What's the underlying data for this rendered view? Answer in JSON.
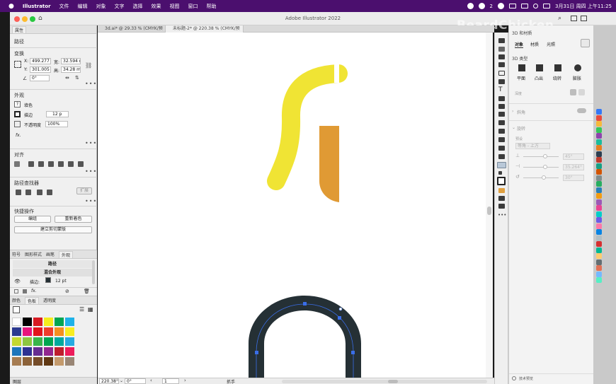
{
  "menubar": {
    "app": "Illustrator",
    "items": [
      "文件",
      "编辑",
      "对象",
      "文字",
      "选择",
      "效果",
      "视图",
      "窗口",
      "帮助"
    ],
    "clock": "3月31日 周四 上午11:25",
    "status_badge": "2"
  },
  "window": {
    "title": "Adobe Illustrator 2022",
    "watermark": "BeardChicken"
  },
  "doc_tabs": [
    "3d.ai* @ 29.33 % (CMYK/预览)",
    "未标题-2* @ 220.38 % (CMYK/预览)"
  ],
  "properties": {
    "tab": "属性",
    "object_type": "路径",
    "transform": {
      "title": "变换",
      "x_label": "X:",
      "x": "499.277",
      "y_label": "Y:",
      "y": "301.005",
      "w_label": "宽:",
      "w": "32.594 r",
      "h_label": "高:",
      "h": "34.28 m",
      "angle": "0°"
    },
    "appearance": {
      "title": "外观",
      "fill_label": "填色",
      "stroke_label": "描边",
      "stroke_value": "12 p",
      "opacity_label": "不透明度",
      "opacity_value": "100%",
      "fx": "fx."
    },
    "align_title": "对齐",
    "pathfinder": {
      "title": "路径查找器",
      "expand": "扩展"
    },
    "quick_actions": {
      "title": "快捷操作",
      "edit": "编组",
      "recolor": "重新着色",
      "clip": "建立剪切蒙版"
    }
  },
  "appearance_panel": {
    "tabs": [
      "符号",
      "图形样式",
      "画笔",
      "外观"
    ],
    "rows": {
      "path": "路径",
      "mixed": "混合外观",
      "stroke_label": "描边:",
      "stroke_value": "12 pt"
    }
  },
  "swatches_panel": {
    "tabs": [
      "颜色",
      "色板",
      "透明度"
    ]
  },
  "bottom_tab": "图层",
  "statusbar": {
    "zoom": "220.38°",
    "angle": "0°",
    "artboard": "1",
    "tool": "抓手"
  },
  "threed_panel": {
    "title": "3D 和材质",
    "tabs": [
      "对象",
      "材质",
      "光照"
    ],
    "section": "3D 类型",
    "types": [
      "平面",
      "凸出",
      "绕转",
      "膨胀"
    ],
    "depth_label": "深度",
    "bevel": "斜角",
    "rotation": "旋转",
    "preset_label": "预设",
    "preset_value": "等角 - 上方",
    "angle1": "45°",
    "angle2": "35.264°",
    "angle3": "30°",
    "footer": "技术预览"
  },
  "colors": {
    "menubar": "#4b0f6e",
    "yellow_curve": "#f0e434",
    "orange_rect": "#e09a34",
    "arch": "#253035",
    "anchor": "#3a6ee8"
  },
  "swatch_colors": [
    "#ffffff",
    "#000000",
    "#d71b23",
    "#f5ec1c",
    "#00a551",
    "#1fb2e8",
    "#2b3990",
    "#e8147d",
    "#e2141c",
    "#ee3d2b",
    "#f48f1f",
    "#f8ed20",
    "#c5d82f",
    "#8dc63f",
    "#39b54a",
    "#00a650",
    "#00a99d",
    "#27aae1",
    "#1c75bc",
    "#2e3192",
    "#662d91",
    "#92278f",
    "#be1e2d",
    "#ed1c5b",
    "#a67c52",
    "#8c6239",
    "#754c29",
    "#603813",
    "#c49a6c",
    "#998675"
  ]
}
